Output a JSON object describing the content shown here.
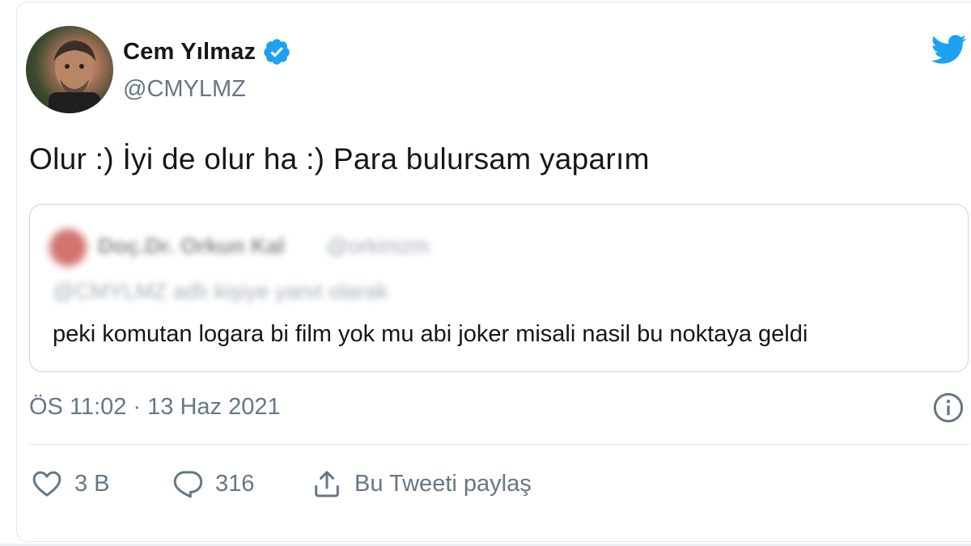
{
  "author": {
    "name": "Cem Yılmaz",
    "handle": "@CMYLMZ",
    "verified": true
  },
  "tweet": {
    "text": "Olur :) İyi de olur ha :) Para bulursam yaparım",
    "timestamp": "ÖS 11:02 · 13 Haz 2021"
  },
  "quoted_tweet": {
    "author_name": "Doç.Dr. Orkun Kal",
    "author_handle": "@orkinizm",
    "reply_context": "@CMYLMZ adlı kişiye yanıt olarak",
    "text": "peki komutan logara bi film yok mu abi joker misali nasil bu noktaya geldi"
  },
  "actions": {
    "like_count": "3 B",
    "reply_count": "316",
    "share_label": "Bu Tweeti paylaş"
  },
  "colors": {
    "twitter_blue": "#1da1f2",
    "text_primary": "#14171a",
    "text_secondary": "#657786",
    "border": "#e1e8ed"
  },
  "icons": {
    "brand": "twitter-bird-icon",
    "verified": "verified-badge-icon",
    "info": "info-icon",
    "like": "heart-icon",
    "reply": "reply-bubble-icon",
    "share": "share-icon"
  }
}
